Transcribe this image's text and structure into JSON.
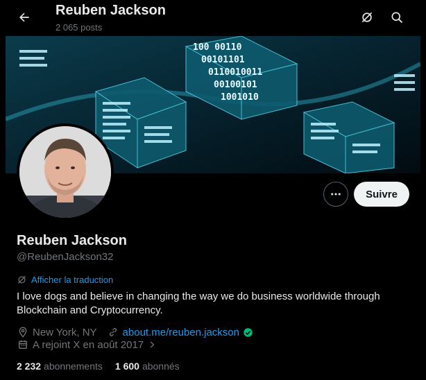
{
  "header": {
    "title": "Reuben Jackson",
    "post_count": "2 065 posts"
  },
  "banner": {
    "digits": [
      "100 00110",
      "00101101",
      "0110010011",
      "00100101",
      "1001010"
    ]
  },
  "profile": {
    "name": "Reuben Jackson",
    "handle": "@ReubenJackson32",
    "follow_label": "Suivre",
    "translate_label": "Afficher la traduction",
    "bio": "I love dogs and believe in changing the way we do business worldwide through Blockchain and Cryptocurrency.",
    "location": "New York, NY",
    "website": "about.me/reuben.jackson",
    "joined": "A rejoint X en août 2017"
  },
  "stats": {
    "following_count": "2 232",
    "following_label": "abonnements",
    "followers_count": "1 600",
    "followers_label": "abonnés"
  },
  "colors": {
    "accent": "#1d9bf0",
    "verified": "#00ba7c",
    "secondary_text": "#71767b"
  }
}
